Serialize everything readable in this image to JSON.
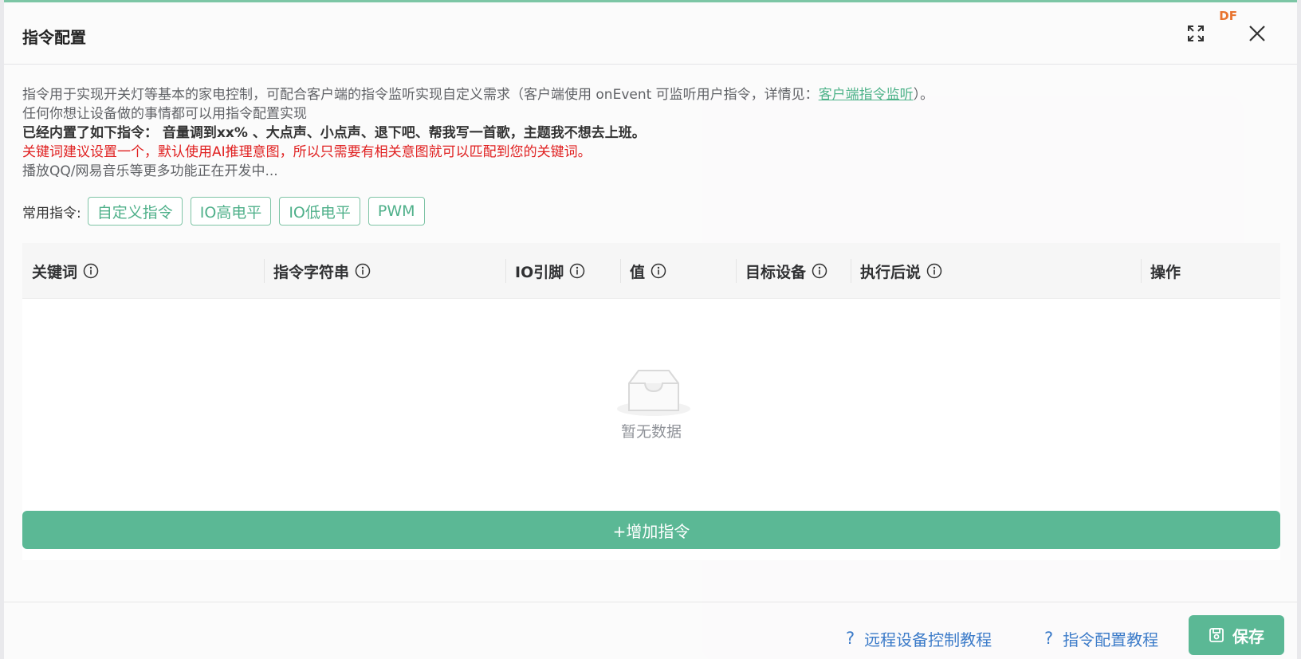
{
  "dialog": {
    "title": "指令配置",
    "brand": "DF"
  },
  "description": {
    "line1_prefix": "指令用于实现开关灯等基本的家电控制，可配合客户端的指令监听实现自定义需求（客户端使用 onEvent 可监听用户指令，详情见：",
    "line1_link": "客户端指令监听",
    "line1_suffix": "）。",
    "line2": "任何你想让设备做的事情都可以用指令配置实现",
    "line3": "已经内置了如下指令： 音量调到xx% 、大点声、小点声、退下吧、帮我写一首歌，主题我不想去上班。",
    "line4": "关键词建议设置一个，默认使用AI推理意图，所以只需要有相关意图就可以匹配到您的关键词。",
    "line5": "播放QQ/网易音乐等更多功能正在开发中..."
  },
  "common": {
    "label": "常用指令:",
    "buttons": [
      "自定义指令",
      "IO高电平",
      "IO低电平",
      "PWM"
    ]
  },
  "table": {
    "columns": [
      "关键词",
      "指令字符串",
      "IO引脚",
      "值",
      "目标设备",
      "执行后说",
      "操作"
    ],
    "empty_text": "暂无数据",
    "add_button": "+增加指令"
  },
  "footer": {
    "remote_tutorial": "远程设备控制教程",
    "command_tutorial": "指令配置教程",
    "save": "保存"
  }
}
